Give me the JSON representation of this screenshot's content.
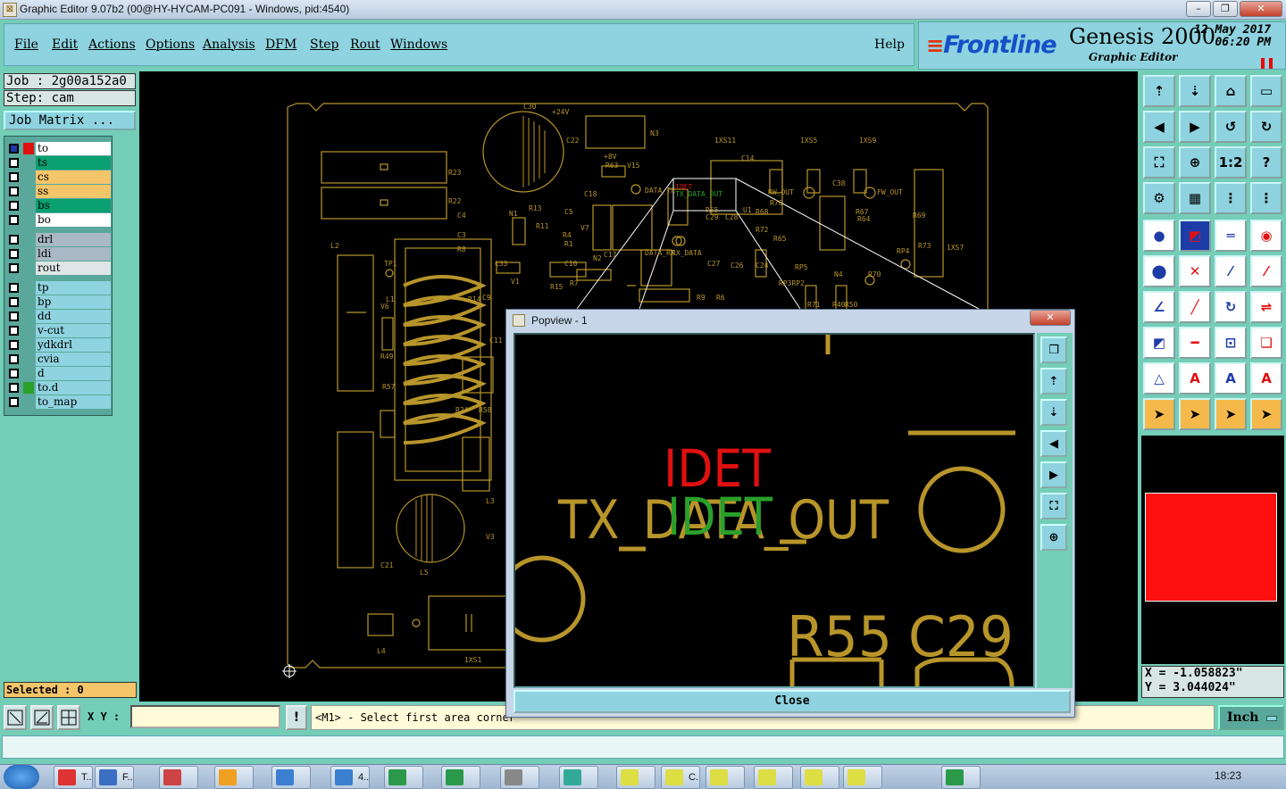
{
  "window": {
    "title": "Graphic Editor 9.07b2 (00@HY-HYCAM-PC091 - Windows, pid:4540)",
    "minimize": "–",
    "maximize": "❐",
    "close": "✕"
  },
  "menu": {
    "items": [
      "File",
      "Edit",
      "Actions",
      "Options",
      "Analysis",
      "DFM",
      "Step",
      "Rout",
      "Windows"
    ],
    "help": "Help"
  },
  "brand": {
    "logo": "Frontline",
    "product": "Genesis 2000",
    "subtitle": "Graphic Editor",
    "date": "12 May 2017",
    "time": "06:20 PM",
    "pause": "❚❚"
  },
  "job": {
    "job": "Job : 2g00a152a0",
    "step": "Step: cam",
    "matrix": "Job Matrix ..."
  },
  "layers": [
    {
      "name": "to",
      "color": "#ffffff",
      "swatch": "#e01010"
    },
    {
      "name": "ts",
      "color": "#0aa070"
    },
    {
      "name": "cs",
      "color": "#f5c56a"
    },
    {
      "name": "ss",
      "color": "#f5c56a"
    },
    {
      "name": "bs",
      "color": "#0aa070"
    },
    {
      "name": "bo",
      "color": "#ffffff"
    },
    {
      "name": "drl",
      "color": "#a8b8c4"
    },
    {
      "name": "ldi",
      "color": "#a8b8c4"
    },
    {
      "name": "rout",
      "color": "#dfe6e6"
    },
    {
      "name": "tp",
      "color": "#8ed3df"
    },
    {
      "name": "bp",
      "color": "#8ed3df"
    },
    {
      "name": "dd",
      "color": "#8ed3df"
    },
    {
      "name": "v-cut",
      "color": "#8ed3df"
    },
    {
      "name": "ydkdrl",
      "color": "#8ed3df"
    },
    {
      "name": "cvia",
      "color": "#8ed3df"
    },
    {
      "name": "d",
      "color": "#8ed3df"
    },
    {
      "name": "to.d",
      "color": "#8ed3df",
      "swatch": "#2aa02a"
    },
    {
      "name": "to_map",
      "color": "#8ed3df"
    }
  ],
  "selected": "Selected : 0",
  "coords": {
    "x": "X = -1.058823\"",
    "y": "Y = 3.044024\""
  },
  "bottom": {
    "xy_label": "X Y :",
    "xy_value": "",
    "excl": "!",
    "prompt": "<M1> - Select first area corner",
    "unit": "Inch"
  },
  "popview": {
    "title": "Popview - 1",
    "close": "Close",
    "x": "✕",
    "labels": {
      "idet_red": "IDET",
      "idet_green": "IDET",
      "tx": "TX_DATA_OUT",
      "r55": "R55",
      "c29": "C29"
    }
  },
  "pcb_labels": [
    "C30",
    "+24V",
    "N3",
    "C22",
    "+8V",
    "R63",
    "V15",
    "1XS11",
    "1XS5",
    "1XS9",
    "R23",
    "R22",
    "C18",
    "DATA_TX",
    "RW_OUT",
    "C38",
    "FW_OUT",
    "C4",
    "N1",
    "R13",
    "C5",
    "R55",
    "C29",
    "C28",
    "U1",
    "R68",
    "R76",
    "R67",
    "R64",
    "R69",
    "L2",
    "C3",
    "R8",
    "R11",
    "R4",
    "R1",
    "V7",
    "C17",
    "DATA_RX",
    "RX_DATA",
    "R72",
    "R65",
    "RP4",
    "R73",
    "1XS7",
    "TP1",
    "C33",
    "C10",
    "R7",
    "N2",
    "C27",
    "C26",
    "C24",
    "RP5",
    "N4",
    "R70",
    "L1",
    "V6",
    "V1",
    "R14",
    "R15",
    "C9",
    "R9",
    "R6",
    "RP3RP2",
    "R71",
    "R40",
    "R50",
    "R49",
    "C11",
    "R24",
    "R58",
    "R57",
    "L3",
    "V3",
    "L5",
    "C21",
    "L4",
    "1XS1",
    "C14"
  ],
  "taskbar": {
    "clock": "18:23",
    "items": [
      "T...",
      "F...",
      "",
      "",
      "",
      "4...",
      "",
      "",
      "",
      "",
      "",
      "C...",
      "",
      "",
      "",
      "",
      ""
    ]
  },
  "colors": {
    "pcb": "#b8952a",
    "red": "#e01010",
    "green": "#2aa02a",
    "panel": "#74cdb7",
    "highlight": "#ff1010"
  }
}
